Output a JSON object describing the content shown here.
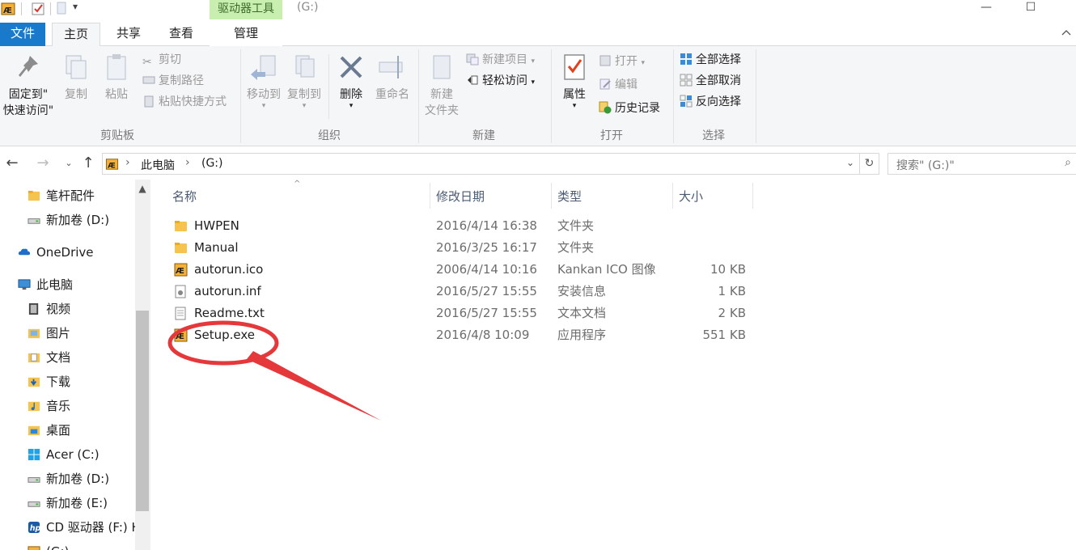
{
  "window": {
    "context_tab": "驱动器工具",
    "title": "(G:)",
    "min": "—",
    "max": "☐",
    "close": "✕"
  },
  "tabs": {
    "file": "文件",
    "home": "主页",
    "share": "共享",
    "view": "查看",
    "manage": "管理"
  },
  "ribbon": {
    "clipboard": {
      "pin_line1": "固定到\"",
      "pin_line2": "快速访问\"",
      "copy": "复制",
      "paste": "粘贴",
      "cut": "剪切",
      "copy_path": "复制路径",
      "paste_shortcut": "粘贴快捷方式",
      "group": "剪贴板"
    },
    "organize": {
      "move_to": "移动到",
      "copy_to": "复制到",
      "delete": "删除",
      "rename": "重命名",
      "group": "组织"
    },
    "new": {
      "new_folder_line1": "新建",
      "new_folder_line2": "文件夹",
      "new_item": "新建项目",
      "easy_access": "轻松访问",
      "group": "新建"
    },
    "open": {
      "properties": "属性",
      "open": "打开",
      "edit": "编辑",
      "history": "历史记录",
      "group": "打开"
    },
    "select": {
      "select_all": "全部选择",
      "select_none": "全部取消",
      "invert": "反向选择",
      "group": "选择"
    }
  },
  "address": {
    "crumb_pc": "此电脑",
    "crumb_drive": "(G:)",
    "search_placeholder": "搜索\" (G:)\""
  },
  "nav": {
    "items": [
      {
        "label": "笔杆配件",
        "icon": "folder-icon"
      },
      {
        "label": "新加卷 (D:)",
        "icon": "drive-icon"
      },
      {
        "label": "OneDrive",
        "icon": "cloud-icon"
      },
      {
        "label": "此电脑",
        "icon": "computer-icon"
      },
      {
        "label": "视频",
        "icon": "video-folder-icon"
      },
      {
        "label": "图片",
        "icon": "pictures-folder-icon"
      },
      {
        "label": "文档",
        "icon": "documents-folder-icon"
      },
      {
        "label": "下载",
        "icon": "downloads-folder-icon"
      },
      {
        "label": "音乐",
        "icon": "music-folder-icon"
      },
      {
        "label": "桌面",
        "icon": "desktop-folder-icon"
      },
      {
        "label": "Acer (C:)",
        "icon": "windows-drive-icon"
      },
      {
        "label": "新加卷 (D:)",
        "icon": "drive-icon"
      },
      {
        "label": "新加卷 (E:)",
        "icon": "drive-icon"
      },
      {
        "label": "CD 驱动器 (F:) H",
        "icon": "hp-cd-icon"
      },
      {
        "label": "(G:)",
        "icon": "drive-g-icon"
      }
    ]
  },
  "columns": {
    "name": "名称",
    "date": "修改日期",
    "type": "类型",
    "size": "大小"
  },
  "files": [
    {
      "name": "HWPEN",
      "date": "2016/4/14 16:38",
      "type": "文件夹",
      "size": "",
      "icon": "folder-icon"
    },
    {
      "name": "Manual",
      "date": "2016/3/25 16:17",
      "type": "文件夹",
      "size": "",
      "icon": "folder-icon"
    },
    {
      "name": "autorun.ico",
      "date": "2006/4/14 10:16",
      "type": "Kankan ICO 图像",
      "size": "10 KB",
      "icon": "kankan-ico-icon"
    },
    {
      "name": "autorun.inf",
      "date": "2016/5/27 15:55",
      "type": "安装信息",
      "size": "1 KB",
      "icon": "setup-info-icon"
    },
    {
      "name": "Readme.txt",
      "date": "2016/5/27 15:55",
      "type": "文本文档",
      "size": "2 KB",
      "icon": "text-file-icon"
    },
    {
      "name": "Setup.exe",
      "date": "2016/4/8 10:09",
      "type": "应用程序",
      "size": "551 KB",
      "icon": "application-icon"
    }
  ],
  "colors": {
    "file_tab": "#1979ca",
    "context_tab": "#c8efb0",
    "annotation": "#e5383b"
  }
}
